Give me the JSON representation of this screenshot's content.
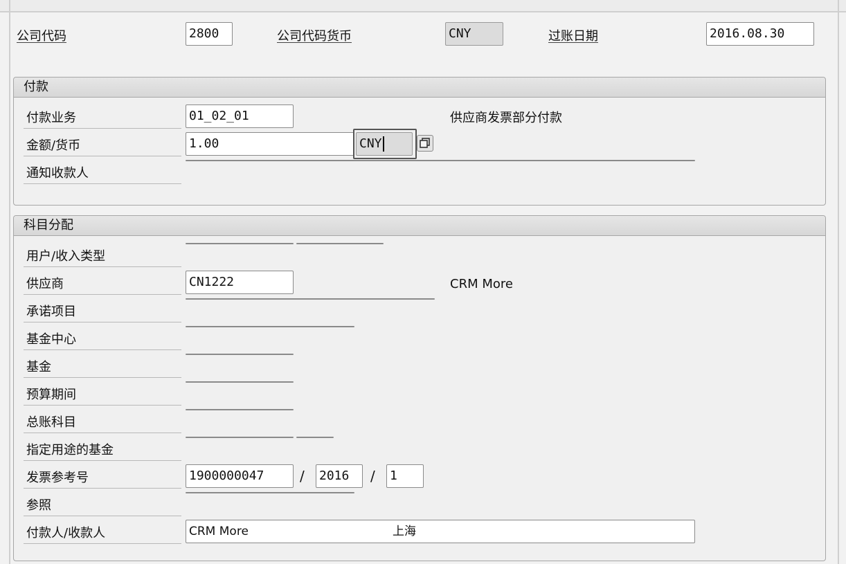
{
  "header": {
    "company_code_label": "公司代码",
    "company_code_value": "2800",
    "company_currency_label": "公司代码货币",
    "company_currency_value": "CNY",
    "posting_date_label": "过账日期",
    "posting_date_value": "2016.08.30"
  },
  "payment": {
    "title": "付款",
    "transaction_label": "付款业务",
    "transaction_value": "01_02_01",
    "transaction_desc": "供应商发票部分付款",
    "amount_label": "金额/货币",
    "amount_value": "1.00",
    "currency_value": "CNY",
    "notify_label": "通知收款人",
    "notify_value": ""
  },
  "account": {
    "title": "科目分配",
    "rows": [
      {
        "label": "用户/收入类型",
        "values": [
          "",
          ""
        ]
      },
      {
        "label": "供应商",
        "values": [
          "CN1222"
        ],
        "desc": "CRM More"
      },
      {
        "label": "承诺项目",
        "values": [
          ""
        ]
      },
      {
        "label": "基金中心",
        "values": [
          ""
        ]
      },
      {
        "label": "基金",
        "values": [
          ""
        ]
      },
      {
        "label": "预算期间",
        "values": [
          ""
        ]
      },
      {
        "label": "总账科目",
        "values": [
          ""
        ]
      },
      {
        "label": "指定用途的基金",
        "values": [
          "",
          ""
        ]
      },
      {
        "label": "发票参考号",
        "values": [
          "1900000047",
          "2016",
          "1"
        ],
        "separators": [
          "/",
          "/"
        ]
      },
      {
        "label": "参照",
        "values": [
          ""
        ]
      },
      {
        "label": "付款人/收款人",
        "values": [
          "CRM More",
          "上海"
        ]
      }
    ]
  }
}
